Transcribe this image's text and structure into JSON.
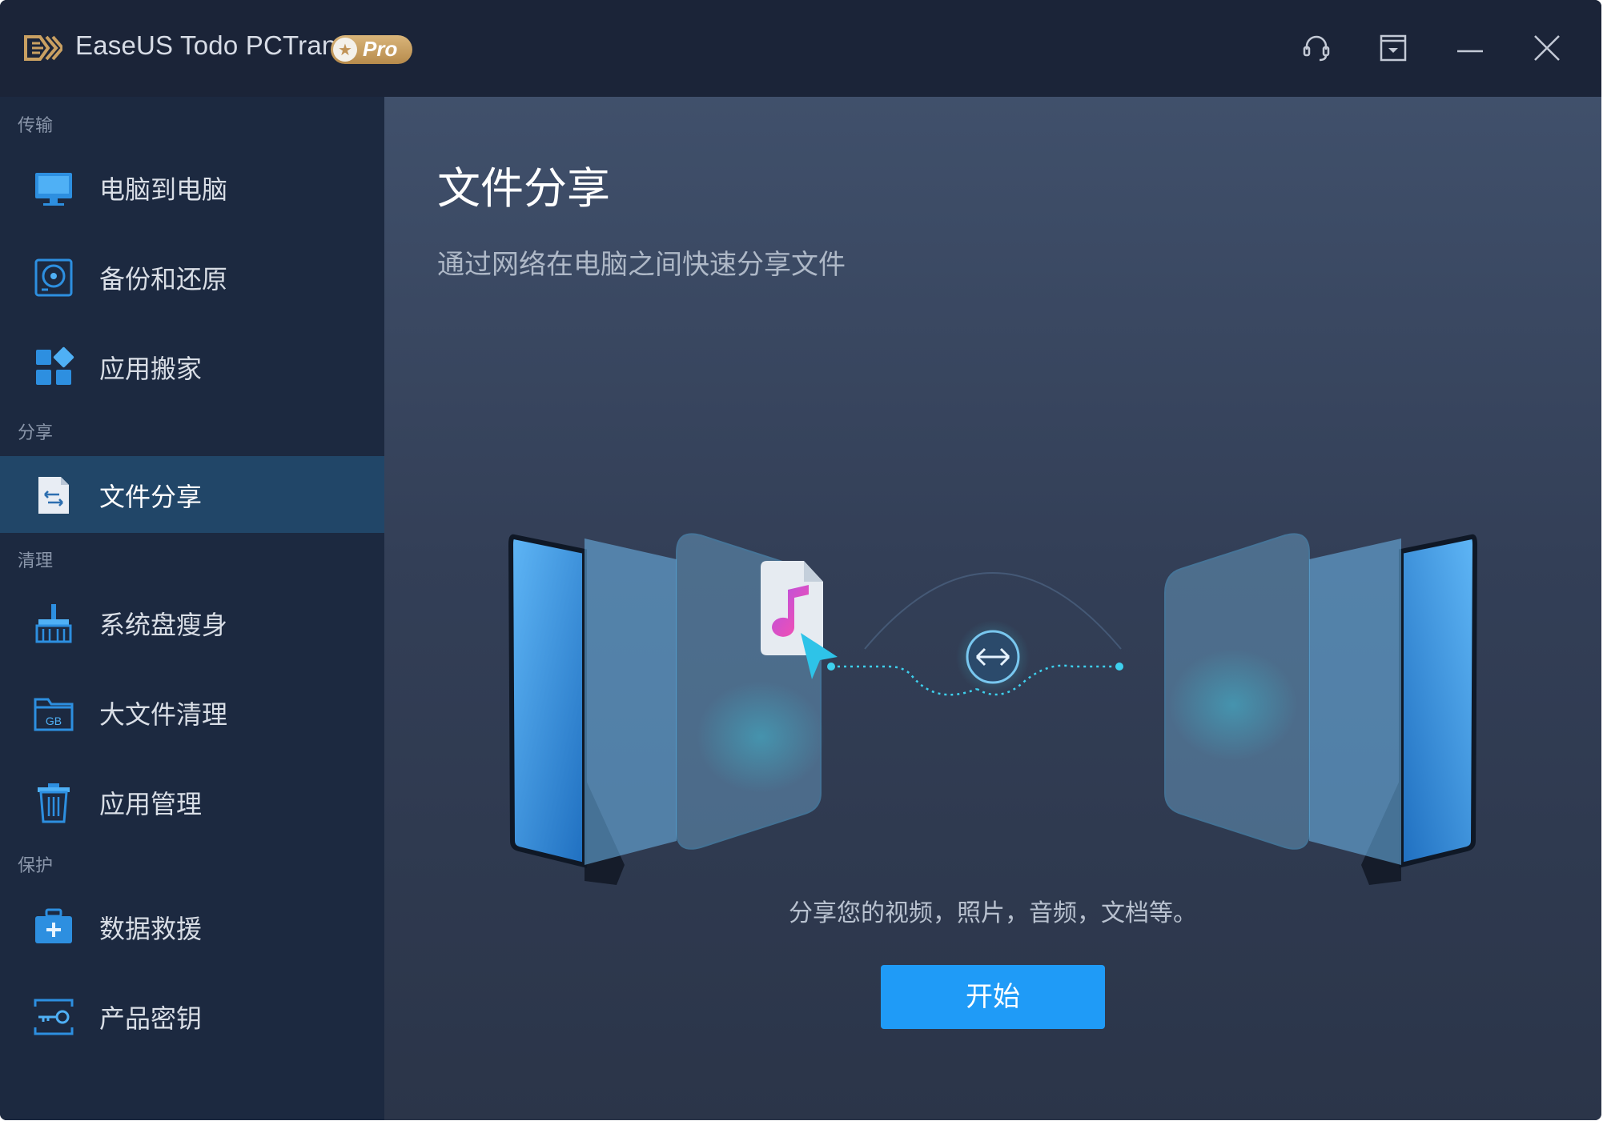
{
  "app": {
    "title": "EaseUS Todo PCTrans",
    "badge": "Pro"
  },
  "titlebar_buttons": [
    {
      "name": "support",
      "icon": "headset-icon"
    },
    {
      "name": "menu",
      "icon": "dropdown-box-icon"
    },
    {
      "name": "minimize",
      "icon": "minimize-icon"
    },
    {
      "name": "close",
      "icon": "close-icon"
    }
  ],
  "sidebar": {
    "sections": [
      {
        "label": "传输",
        "items": [
          {
            "label": "电脑到电脑",
            "icon": "monitor-icon"
          },
          {
            "label": "备份和还原",
            "icon": "disk-icon"
          },
          {
            "label": "应用搬家",
            "icon": "apps-grid-icon"
          }
        ]
      },
      {
        "label": "分享",
        "items": [
          {
            "label": "文件分享",
            "icon": "file-share-icon",
            "active": true
          }
        ]
      },
      {
        "label": "清理",
        "items": [
          {
            "label": "系统盘瘦身",
            "icon": "broom-icon"
          },
          {
            "label": "大文件清理",
            "icon": "gb-folder-icon"
          },
          {
            "label": "应用管理",
            "icon": "trash-icon"
          }
        ]
      },
      {
        "label": "保护",
        "items": [
          {
            "label": "数据救援",
            "icon": "rescue-kit-icon"
          },
          {
            "label": "产品密钥",
            "icon": "key-icon"
          }
        ]
      }
    ]
  },
  "main": {
    "title": "文件分享",
    "subtitle": "通过网络在电脑之间快速分享文件",
    "caption": "分享您的视频，照片，音频，文档等。",
    "start_label": "开始"
  },
  "colors": {
    "accent": "#1f9bf7",
    "sidebar_bg": "#1c2940",
    "active_item_bg": "#214668",
    "titlebar_bg": "#1b2438",
    "badge_gold": "#c9a062",
    "icon_blue": "#2d8fe0"
  }
}
